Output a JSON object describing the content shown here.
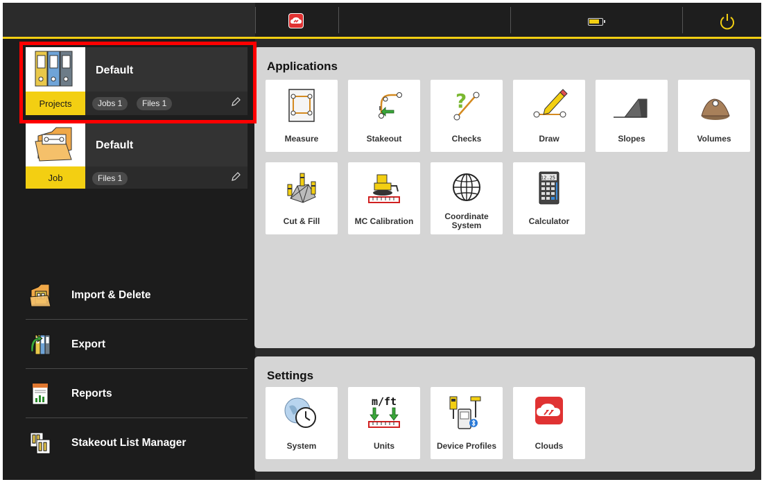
{
  "project_card": {
    "title": "Default",
    "tag": "Projects",
    "pills": [
      "Jobs 1",
      "Files 1"
    ]
  },
  "job_card": {
    "title": "Default",
    "tag": "Job",
    "pills": [
      "Files 1"
    ]
  },
  "left_menu": [
    {
      "label": "Import & Delete",
      "icon": "import-delete-icon"
    },
    {
      "label": "Export",
      "icon": "export-icon"
    },
    {
      "label": "Reports",
      "icon": "reports-icon"
    },
    {
      "label": "Stakeout List Manager",
      "icon": "stakeout-list-icon"
    }
  ],
  "applications": {
    "title": "Applications",
    "tiles": [
      {
        "label": "Measure",
        "icon": "measure-icon"
      },
      {
        "label": "Stakeout",
        "icon": "stakeout-icon"
      },
      {
        "label": "Checks",
        "icon": "checks-icon"
      },
      {
        "label": "Draw",
        "icon": "draw-icon"
      },
      {
        "label": "Slopes",
        "icon": "slopes-icon"
      },
      {
        "label": "Volumes",
        "icon": "volumes-icon"
      },
      {
        "label": "Cut & Fill",
        "icon": "cut-fill-icon"
      },
      {
        "label": "MC Calibration",
        "icon": "mc-calibration-icon"
      },
      {
        "label": "Coordinate System",
        "icon": "globe-icon"
      },
      {
        "label": "Calculator",
        "icon": "calculator-icon"
      }
    ]
  },
  "settings": {
    "title": "Settings",
    "tiles": [
      {
        "label": "System",
        "icon": "system-clock-icon"
      },
      {
        "label": "Units",
        "icon": "units-icon"
      },
      {
        "label": "Device Profiles",
        "icon": "device-profiles-icon"
      },
      {
        "label": "Clouds",
        "icon": "clouds-icon"
      }
    ],
    "units_glyph": "m/ft"
  },
  "calculator_display": "12.25",
  "colors": {
    "accent": "#f3cf12",
    "cloud_red": "#e03232",
    "highlight": "#ff0000",
    "panel": "#d5d5d5"
  }
}
